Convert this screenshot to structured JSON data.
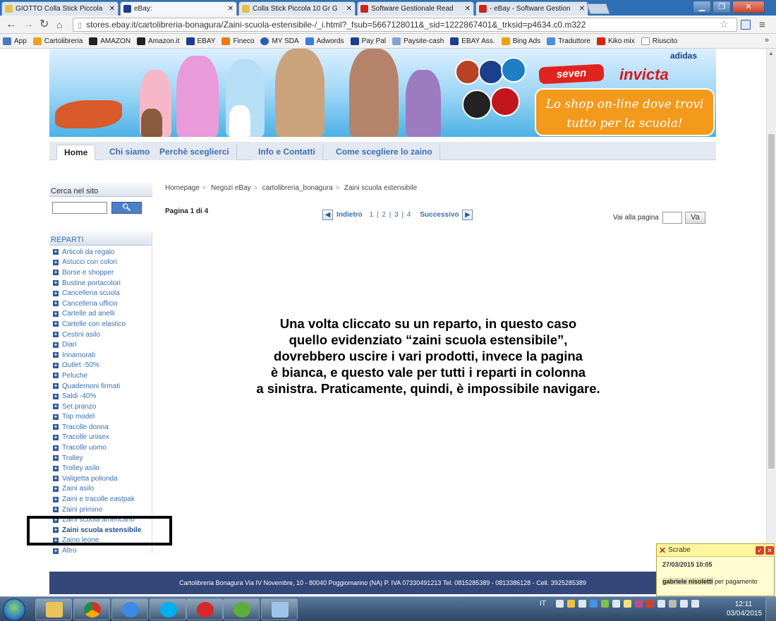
{
  "browser": {
    "tabs": [
      {
        "title": "GIOTTO Colla Stick Piccola",
        "color": "#e0c44a"
      },
      {
        "title": "eBay:",
        "color": "#1d3c8d"
      },
      {
        "title": "Colla Stick Piccola 10 Gr G",
        "color": "#e0c44a"
      },
      {
        "title": "Software Gestionale Read",
        "color": "#c8281c"
      },
      {
        "title": "- eBay - Software Gestion",
        "color": "#c8281c"
      }
    ],
    "url": "stores.ebay.it/cartolibreria-bonagura/Zaini-scuola-estensibile-/_i.html?_fsub=5667128011&_sid=1222867401&_trksid=p4634.c0.m322",
    "bookmarks": [
      "App",
      "Cartolibreria",
      "AMAZON",
      "Amazon.it",
      "EBAY",
      "Fineco",
      "MY SDA",
      "Adwords",
      "Pay Pal",
      "Paysite-cash",
      "EBAY Ass.",
      "Bing Ads",
      "Traduttore",
      "Kiko mix",
      "Riuscito"
    ]
  },
  "banner": {
    "brand1": "seven",
    "brand2": "invicta",
    "brand3": "adidas",
    "slogan": "Lo shop on-line dove trovi tutto per la scuola!"
  },
  "store_nav": [
    "Home",
    "Chi siamo",
    "Perchè sceglierci",
    "Info e Contatti",
    "Come scegliere lo zaino"
  ],
  "sidebar": {
    "search_title": "Cerca nel sito",
    "search_button": "Cerca",
    "reparti_title": "REPARTI",
    "categories": [
      "Articoli da regalo",
      "Astucci con colori",
      "Borse e shopper",
      "Bustine portacolori",
      "Cancelleria scuola",
      "Cancelleria ufficio",
      "Cartelle ad anelli",
      "Cartelle con elastico",
      "Cestini asilo",
      "Diari",
      "Innamorati",
      "Outlet -50%",
      "Peluche",
      "Quadernoni firmati",
      "Saldi -40%",
      "Set pranzo",
      "Top model",
      "Tracolle donna",
      "Tracolle unisex",
      "Tracolle uomo",
      "Trolley",
      "Trolley asilo",
      "Valigetta polionda",
      "Zaini asilo",
      "Zaini e tracolle eastpak",
      "Zaini primino",
      "Zaini scuola americano",
      "Zaini scuola estensibile",
      "Zaino leone",
      "Altro"
    ],
    "selected": "Zaini scuola estensibile"
  },
  "breadcrumb": [
    "Homepage",
    "Negozi eBay",
    "cartolibreria_bonagura",
    "Zaini scuola estensibile"
  ],
  "pagination": {
    "page_info": "Pagina 1 di 4",
    "prev": "Indietro",
    "numbers": "1 | 2 | 3 | 4",
    "next": "Successivo",
    "goto_label": "Vai alla pagina",
    "goto_button": "Va"
  },
  "note": "Una volta cliccato su un reparto, in questo caso\nquello evidenziato “zaini scuola estensibile”,\ndovrebbero uscire i vari prodotti, invece la pagina\nè bianca, e questo vale per tutti i reparti in colonna\na sinistra. Praticamente, quindi, è impossibile navigare.",
  "footer": "Cartolibreria Bonagura Via IV Novembre, 10 - 80040 Poggiomarino (NA) P. IVA 07330491213 Tel. 0815285389 - 0813386128 - Cell. 3925285389",
  "popup": {
    "title": "Scrabe",
    "date": "27/03/2015  10:05",
    "sender": "gabriele nisoletti",
    "message": "per pagamento"
  },
  "taskbar": {
    "lang": "IT",
    "time": "12:11",
    "date": "03/04/2015"
  }
}
